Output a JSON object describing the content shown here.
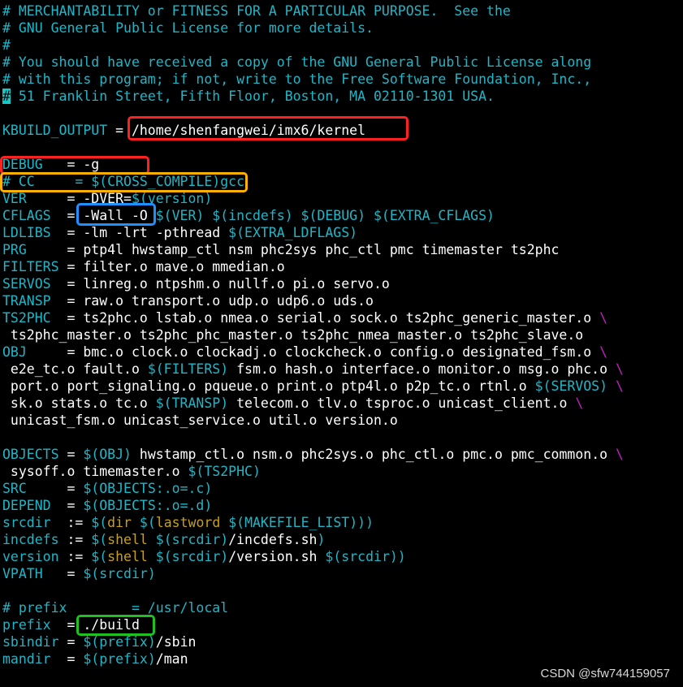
{
  "editor": {
    "lines": [
      [
        {
          "t": "# MERCHANTABILITY or FITNESS FOR A PARTICULAR PURPOSE.  See the",
          "c": "cm"
        }
      ],
      [
        {
          "t": "# GNU General Public License for more details.",
          "c": "cm"
        }
      ],
      [
        {
          "t": "#",
          "c": "cm"
        }
      ],
      [
        {
          "t": "# You should have received a copy of the GNU General Public License along",
          "c": "cm"
        }
      ],
      [
        {
          "t": "# with this program; if not, write to the Free Software Foundation, Inc.,",
          "c": "cm"
        }
      ],
      [
        {
          "t": "#",
          "c": "cur"
        },
        {
          "t": " 51 Franklin Street, Fifth Floor, Boston, MA 02110-1301 USA.",
          "c": "cm"
        }
      ],
      [
        {
          "t": "",
          "c": "tx"
        }
      ],
      [
        {
          "t": "KBUILD_OUTPUT",
          "c": "vr"
        },
        {
          "t": " = /home/shenfangwei/imx6/kernel",
          "c": "tx"
        }
      ],
      [
        {
          "t": "",
          "c": "tx"
        }
      ],
      [
        {
          "t": "DEBUG",
          "c": "vr"
        },
        {
          "t": "   = -g",
          "c": "tx"
        }
      ],
      [
        {
          "t": "# CC     = $(CROSS_COMPILE)gcc",
          "c": "cm"
        }
      ],
      [
        {
          "t": "VER",
          "c": "vr"
        },
        {
          "t": "     = -DVER=",
          "c": "tx"
        },
        {
          "t": "$(version)",
          "c": "mc"
        }
      ],
      [
        {
          "t": "CFLAGS",
          "c": "vr"
        },
        {
          "t": "  = -Wall -O ",
          "c": "tx"
        },
        {
          "t": "$(VER) $(incdefs) $(DEBUG) $(EXTRA_CFLAGS)",
          "c": "mc"
        }
      ],
      [
        {
          "t": "LDLIBS",
          "c": "vr"
        },
        {
          "t": "  = -lm -lrt -pthread ",
          "c": "tx"
        },
        {
          "t": "$(EXTRA_LDFLAGS)",
          "c": "mc"
        }
      ],
      [
        {
          "t": "PRG",
          "c": "vr"
        },
        {
          "t": "     = ptp4l hwstamp_ctl nsm phc2sys phc_ctl pmc timemaster ts2phc",
          "c": "tx"
        }
      ],
      [
        {
          "t": "FILTERS",
          "c": "vr"
        },
        {
          "t": " = filter.o mave.o mmedian.o",
          "c": "tx"
        }
      ],
      [
        {
          "t": "SERVOS",
          "c": "vr"
        },
        {
          "t": "  = linreg.o ntpshm.o nullf.o pi.o servo.o",
          "c": "tx"
        }
      ],
      [
        {
          "t": "TRANSP",
          "c": "vr"
        },
        {
          "t": "  = raw.o transport.o udp.o udp6.o uds.o",
          "c": "tx"
        }
      ],
      [
        {
          "t": "TS2PHC",
          "c": "vr"
        },
        {
          "t": "  = ts2phc.o lstab.o nmea.o serial.o sock.o ts2phc_generic_master.o ",
          "c": "tx"
        },
        {
          "t": "\\",
          "c": "bs"
        }
      ],
      [
        {
          "t": " ts2phc_master.o ts2phc_phc_master.o ts2phc_nmea_master.o ts2phc_slave.o",
          "c": "tx"
        }
      ],
      [
        {
          "t": "OBJ",
          "c": "vr"
        },
        {
          "t": "     = bmc.o clock.o clockadj.o clockcheck.o config.o designated_fsm.o ",
          "c": "tx"
        },
        {
          "t": "\\",
          "c": "bs"
        }
      ],
      [
        {
          "t": " e2e_tc.o fault.o ",
          "c": "tx"
        },
        {
          "t": "$(FILTERS)",
          "c": "mc"
        },
        {
          "t": " fsm.o hash.o interface.o monitor.o msg.o phc.o ",
          "c": "tx"
        },
        {
          "t": "\\",
          "c": "bs"
        }
      ],
      [
        {
          "t": " port.o port_signaling.o pqueue.o print.o ptp4l.o p2p_tc.o rtnl.o ",
          "c": "tx"
        },
        {
          "t": "$(SERVOS)",
          "c": "mc"
        },
        {
          "t": " ",
          "c": "tx"
        },
        {
          "t": "\\",
          "c": "bs"
        }
      ],
      [
        {
          "t": " sk.o stats.o tc.o ",
          "c": "tx"
        },
        {
          "t": "$(TRANSP)",
          "c": "mc"
        },
        {
          "t": " telecom.o tlv.o tsproc.o unicast_client.o ",
          "c": "tx"
        },
        {
          "t": "\\",
          "c": "bs"
        }
      ],
      [
        {
          "t": " unicast_fsm.o unicast_service.o util.o version.o",
          "c": "tx"
        }
      ],
      [
        {
          "t": "",
          "c": "tx"
        }
      ],
      [
        {
          "t": "OBJECTS",
          "c": "vr"
        },
        {
          "t": " = ",
          "c": "tx"
        },
        {
          "t": "$(OBJ)",
          "c": "mc"
        },
        {
          "t": " hwstamp_ctl.o nsm.o phc2sys.o phc_ctl.o pmc.o pmc_common.o ",
          "c": "tx"
        },
        {
          "t": "\\",
          "c": "bs"
        }
      ],
      [
        {
          "t": " sysoff.o timemaster.o ",
          "c": "tx"
        },
        {
          "t": "$(TS2PHC)",
          "c": "mc"
        }
      ],
      [
        {
          "t": "SRC",
          "c": "vr"
        },
        {
          "t": "     = ",
          "c": "tx"
        },
        {
          "t": "$(OBJECTS:.o=.c)",
          "c": "mc"
        }
      ],
      [
        {
          "t": "DEPEND",
          "c": "vr"
        },
        {
          "t": "  = ",
          "c": "tx"
        },
        {
          "t": "$(OBJECTS:.o=.d)",
          "c": "mc"
        }
      ],
      [
        {
          "t": "srcdir",
          "c": "vr"
        },
        {
          "t": "  := ",
          "c": "tx"
        },
        {
          "t": "$(",
          "c": "mc"
        },
        {
          "t": "dir",
          "c": "fn"
        },
        {
          "t": " $(",
          "c": "mc"
        },
        {
          "t": "lastword",
          "c": "fn"
        },
        {
          "t": " $(MAKEFILE_LIST)))",
          "c": "mc"
        }
      ],
      [
        {
          "t": "incdefs",
          "c": "vr"
        },
        {
          "t": " := ",
          "c": "tx"
        },
        {
          "t": "$(",
          "c": "mc"
        },
        {
          "t": "shell",
          "c": "fn"
        },
        {
          "t": " $(srcdir)",
          "c": "mc"
        },
        {
          "t": "/incdefs.sh",
          "c": "tx"
        },
        {
          "t": ")",
          "c": "mc"
        }
      ],
      [
        {
          "t": "version",
          "c": "vr"
        },
        {
          "t": " := ",
          "c": "tx"
        },
        {
          "t": "$(",
          "c": "mc"
        },
        {
          "t": "shell",
          "c": "fn"
        },
        {
          "t": " $(srcdir)",
          "c": "mc"
        },
        {
          "t": "/version.sh ",
          "c": "tx"
        },
        {
          "t": "$(srcdir))",
          "c": "mc"
        }
      ],
      [
        {
          "t": "VPATH",
          "c": "vr"
        },
        {
          "t": "   = ",
          "c": "tx"
        },
        {
          "t": "$(srcdir)",
          "c": "mc"
        }
      ],
      [
        {
          "t": "",
          "c": "tx"
        }
      ],
      [
        {
          "t": "# prefix        = /usr/local",
          "c": "cm"
        }
      ],
      [
        {
          "t": "prefix",
          "c": "vr"
        },
        {
          "t": "  = ./build",
          "c": "tx"
        }
      ],
      [
        {
          "t": "sbindir",
          "c": "vr"
        },
        {
          "t": " = ",
          "c": "tx"
        },
        {
          "t": "$(prefix)",
          "c": "mc"
        },
        {
          "t": "/sbin",
          "c": "tx"
        }
      ],
      [
        {
          "t": "mandir",
          "c": "vr"
        },
        {
          "t": "  = ",
          "c": "tx"
        },
        {
          "t": "$(prefix)",
          "c": "mc"
        },
        {
          "t": "/man",
          "c": "tx"
        }
      ]
    ]
  },
  "highlight_colors": {
    "red": "#ff2020",
    "orange": "#ffb000",
    "blue": "#1e90ff",
    "green": "#20c020"
  },
  "watermark": "CSDN @sfw744159057"
}
